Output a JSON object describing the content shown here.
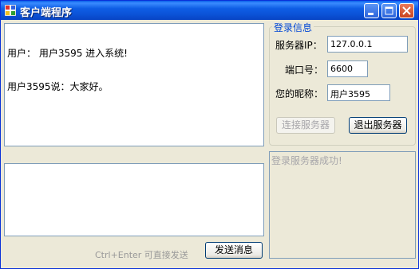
{
  "window": {
    "title": "客户端程序",
    "icons": {
      "app": "app-icon",
      "minimize": "minimize-icon",
      "maximize": "maximize-icon",
      "close": "close-icon"
    }
  },
  "chat": {
    "messages": [
      "用户： 用户3595 进入系统!",
      "用户3595说：大家好。"
    ],
    "input_value": ""
  },
  "compose": {
    "hint": "Ctrl+Enter 可直接发送",
    "send_label": "发送消息"
  },
  "login": {
    "group_title": "登录信息",
    "server_ip_label": "服务器IP：",
    "server_ip_value": "127.0.0.1",
    "port_label": "端口号：",
    "port_value": "6600",
    "nickname_label": "您的昵称：",
    "nickname_value": "用户3595",
    "connect_label": "连接服务器",
    "disconnect_label": "退出服务器"
  },
  "status": {
    "text": "登录服务器成功!"
  },
  "colors": {
    "titlebar": "#0A5FE8",
    "group_title": "#0046D5",
    "window_bg": "#ECE9D8",
    "close_button": "#C8431F"
  }
}
